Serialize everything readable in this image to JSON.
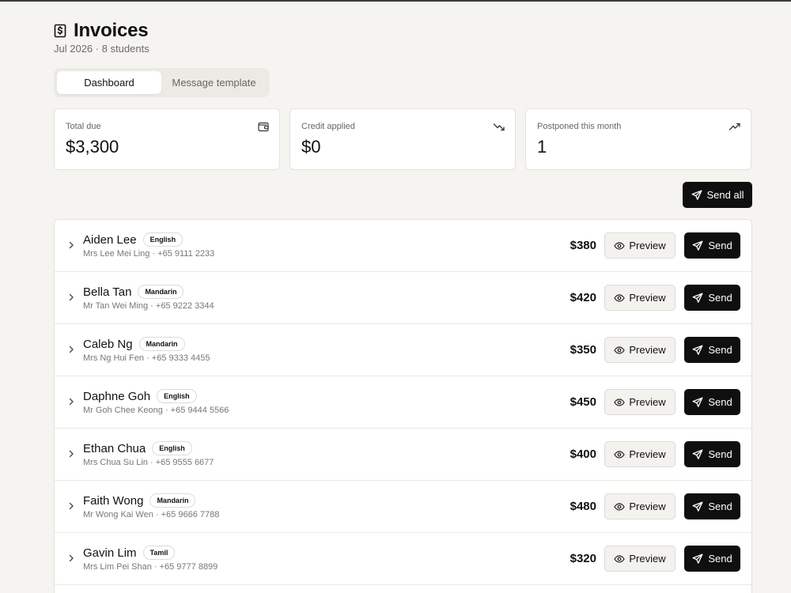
{
  "header": {
    "title": "Invoices",
    "subtitle": "Jul 2026 · 8 students",
    "icon": "dollar-receipt-icon"
  },
  "tabs": [
    {
      "label": "Dashboard",
      "active": true
    },
    {
      "label": "Message template",
      "active": false
    }
  ],
  "stats": [
    {
      "label": "Total due",
      "value": "$3,300",
      "icon": "wallet-icon"
    },
    {
      "label": "Credit applied",
      "value": "$0",
      "icon": "trending-down-icon"
    },
    {
      "label": "Postponed this month",
      "value": "1",
      "icon": "trending-up-icon"
    }
  ],
  "actions": {
    "send_all_label": "Send all",
    "preview_label": "Preview",
    "send_label": "Send"
  },
  "students": [
    {
      "name": "Aiden Lee",
      "language": "English",
      "contact": "Mrs Lee Mei Ling · +65 9111 2233",
      "amount": "$380"
    },
    {
      "name": "Bella Tan",
      "language": "Mandarin",
      "contact": "Mr Tan Wei Ming · +65 9222 3344",
      "amount": "$420"
    },
    {
      "name": "Caleb Ng",
      "language": "Mandarin",
      "contact": "Mrs Ng Hui Fen · +65 9333 4455",
      "amount": "$350"
    },
    {
      "name": "Daphne Goh",
      "language": "English",
      "contact": "Mr Goh Chee Keong · +65 9444 5566",
      "amount": "$450"
    },
    {
      "name": "Ethan Chua",
      "language": "English",
      "contact": "Mrs Chua Su Lin · +65 9555 6677",
      "amount": "$400"
    },
    {
      "name": "Faith Wong",
      "language": "Mandarin",
      "contact": "Mr Wong Kai Wen · +65 9666 7788",
      "amount": "$480"
    },
    {
      "name": "Gavin Lim",
      "language": "Tamil",
      "contact": "Mrs Lim Pei Shan · +65 9777 8899",
      "amount": "$320"
    }
  ]
}
